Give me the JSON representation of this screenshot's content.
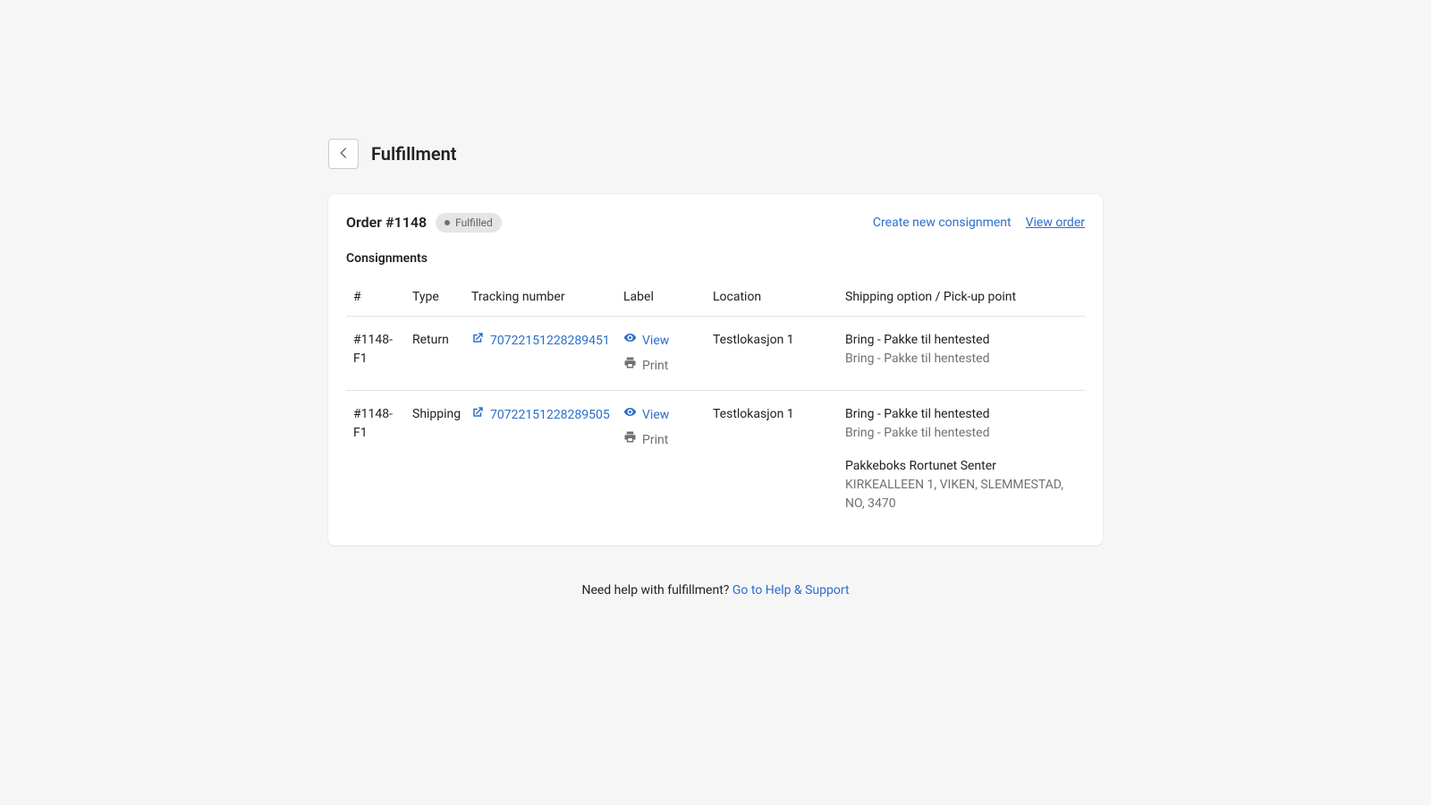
{
  "header": {
    "title": "Fulfillment"
  },
  "order": {
    "title": "Order #1148",
    "status": "Fulfilled"
  },
  "actions": {
    "create": "Create new consignment",
    "view_order": "View order"
  },
  "table": {
    "heading": "Consignments",
    "columns": {
      "id": "#",
      "type": "Type",
      "tracking": "Tracking number",
      "label": "Label",
      "location": "Location",
      "shipping": "Shipping option / Pick-up point"
    },
    "labels": {
      "view": "View",
      "print": "Print"
    },
    "rows": [
      {
        "id": "#1148-F1",
        "type": "Return",
        "tracking": "70722151228289451",
        "location": "Testlokasjon 1",
        "shipping_primary": "Bring - Pakke til hentested",
        "shipping_secondary": "Bring - Pakke til hentested",
        "pickup_title": "",
        "pickup_address": ""
      },
      {
        "id": "#1148-F1",
        "type": "Shipping",
        "tracking": "70722151228289505",
        "location": "Testlokasjon 1",
        "shipping_primary": "Bring - Pakke til hentested",
        "shipping_secondary": "Bring - Pakke til hentested",
        "pickup_title": "Pakkeboks Rortunet Senter",
        "pickup_address": "KIRKEALLEEN 1, VIKEN, SLEMMESTAD, NO, 3470"
      }
    ]
  },
  "help": {
    "text": "Need help with fulfillment? ",
    "link": "Go to Help & Support"
  }
}
